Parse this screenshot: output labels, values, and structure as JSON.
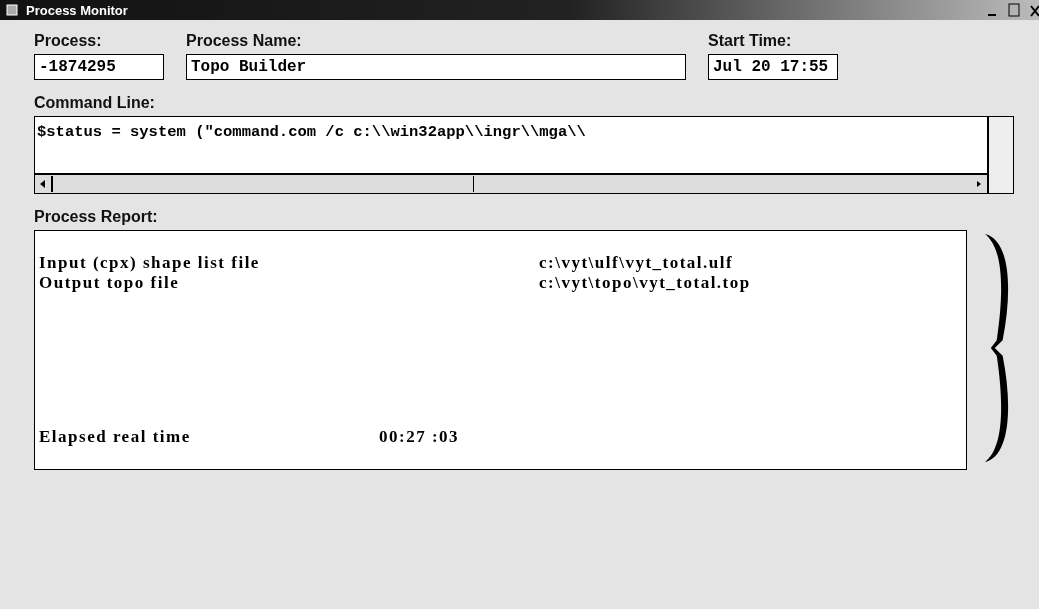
{
  "window": {
    "title": "Process Monitor"
  },
  "fields": [
    {
      "label": "Process:",
      "value": "-1874295",
      "kind": "short"
    },
    {
      "label": "Process Name:",
      "value": "Topo Builder",
      "kind": "wide"
    },
    {
      "label": "Start Time:",
      "value": "Jul 20  17:55",
      "kind": "short"
    }
  ],
  "command_line": {
    "label": "Command Line:",
    "value": "$status = system (\"command.com /c c:\\\\win32app\\\\ingr\\\\mga\\\\"
  },
  "report": {
    "label": "Process Report:",
    "lines": [
      {
        "label": "Input (cpx) shape list file",
        "value": "c:\\vyt\\ulf\\vyt_total.ulf"
      },
      {
        "label": "Output topo file",
        "value": "c:\\vyt\\topo\\vyt_total.top"
      }
    ],
    "elapsed": {
      "label": "Elapsed real time",
      "value": "00:27 :03"
    }
  }
}
